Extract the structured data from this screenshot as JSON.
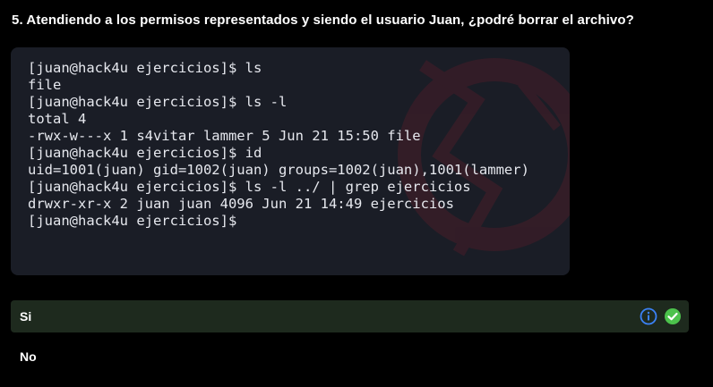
{
  "question": {
    "text": "5. Atendiendo a los permisos representados y siendo el usuario Juan, ¿podré borrar el archivo?"
  },
  "terminal": {
    "lines": [
      "[juan@hack4u ejercicios]$ ls",
      "file",
      "[juan@hack4u ejercicios]$ ls -l",
      "total 4",
      "-rwx-w---x 1 s4vitar lammer 5 Jun 21 15:50 file",
      "[juan@hack4u ejercicios]$ id",
      "uid=1001(juan) gid=1002(juan) groups=1002(juan),1001(lammer)",
      "[juan@hack4u ejercicios]$ ls -l ../ | grep ejercicios",
      "drwxr-xr-x 2 juan juan 4096 Jun 21 14:49 ejercicios",
      "[juan@hack4u ejercicios]$"
    ]
  },
  "options": [
    {
      "label": "Si",
      "selected": true,
      "icons": [
        "info-icon",
        "check-circle-icon"
      ]
    },
    {
      "label": "No",
      "selected": false
    }
  ],
  "colors": {
    "background": "#000000",
    "terminal_bg": "#1a1d26",
    "selected_option_bg": "#1e2a1e",
    "info_icon": "#3b82f6",
    "check_icon": "#4cc24c"
  }
}
